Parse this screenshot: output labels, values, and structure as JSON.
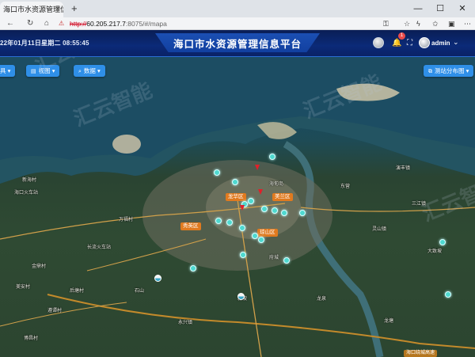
{
  "browser": {
    "tab_title": "海口市水资源管理信息",
    "tab_close": "×",
    "new_tab": "+",
    "window_buttons": [
      "—",
      "☐",
      "✕"
    ],
    "url_protocol": "http://",
    "url_host": "60.205.217.7",
    "url_path": ":8075/#/mapa",
    "nav_icons": [
      "back-arrow-icon",
      "refresh-icon",
      "home-icon"
    ]
  },
  "header": {
    "datetime": "22年01月11日星期二 08:55:45",
    "title": "海口市水资源管理信息平台",
    "notification_count": "1",
    "username": "admin",
    "user_chevron": "⌄"
  },
  "toolbar": {
    "tools_label": "具 ▾",
    "view_label": "视图 ▾",
    "data_label": "数据 ▾",
    "station_layer_label": "测站分布图 ▾"
  },
  "map": {
    "districts": [
      {
        "name": "龙华区",
        "color": "#e07a1f"
      },
      {
        "name": "美兰区",
        "color": "#e07a1f"
      },
      {
        "name": "秀英区",
        "color": "#e07a1f"
      },
      {
        "name": "琼山区",
        "color": "#e07a1f"
      }
    ],
    "places": [
      "海口火车站",
      "长流火车站",
      "新海村",
      "金鼎村",
      "后塘村",
      "万福村",
      "海甸岛",
      "府城",
      "东营",
      "演丰镇",
      "三江镇",
      "大致坡",
      "灵山镇",
      "永兴镇",
      "石山",
      "遵谭村",
      "美安村",
      "博昌村",
      "新坡",
      "龙泉",
      "龙塘"
    ],
    "highway_label": "海口绕城高速",
    "watermark": "汇云智能"
  },
  "colors": {
    "header_bg": "#0b2a78",
    "button_bg": "#2f8fe8",
    "marker": "#4fd9d0",
    "alert_pin": "#e0202a"
  }
}
